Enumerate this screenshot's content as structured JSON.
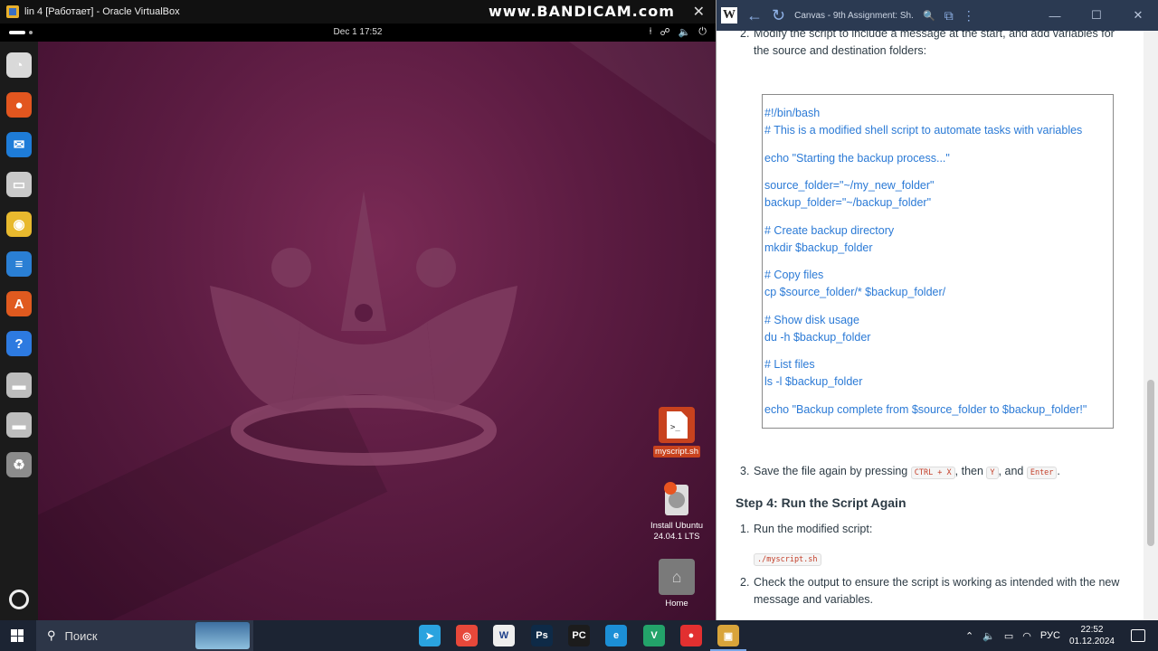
{
  "vbox": {
    "window_title": "lin 4 [Работает] - Oracle VirtualBox",
    "watermark": "www.BANDICAM.com",
    "close": "✕"
  },
  "ubuntu": {
    "clock": "Dec 1  17:52",
    "tray": [
      "⍿",
      "☍",
      "🔈",
      "⏻"
    ],
    "desktop_icons": [
      {
        "label": "myscript.sh",
        "icon": "script-file-icon",
        "selected": true
      },
      {
        "label": "Install Ubuntu 24.04.1 LTS",
        "icon": "ubuntu-installer-icon",
        "selected": false
      },
      {
        "label": "Home",
        "icon": "home-folder-icon",
        "selected": false
      }
    ],
    "dock": [
      {
        "name": "ubuntu-installer-icon",
        "glyph": "◔",
        "color": "#d9d9d9"
      },
      {
        "name": "firefox-icon",
        "glyph": "●",
        "color": "#e2561f"
      },
      {
        "name": "thunderbird-icon",
        "glyph": "✉",
        "color": "#1e7cd8"
      },
      {
        "name": "files-icon",
        "glyph": "▭",
        "color": "#c9c9c9"
      },
      {
        "name": "rhythmbox-icon",
        "glyph": "◉",
        "color": "#e8b92e"
      },
      {
        "name": "writer-icon",
        "glyph": "≡",
        "color": "#2a7fd4"
      },
      {
        "name": "app-center-icon",
        "glyph": "A",
        "color": "#e05a1f"
      },
      {
        "name": "help-icon",
        "glyph": "?",
        "color": "#2d7ae0"
      },
      {
        "name": "drive-icon",
        "glyph": "▬",
        "color": "#bdbdbd"
      },
      {
        "name": "drive-icon-2",
        "glyph": "▬",
        "color": "#bdbdbd"
      },
      {
        "name": "trash-icon",
        "glyph": "♻",
        "color": "#8c8c8c"
      }
    ]
  },
  "browser": {
    "tab_title": "Canvas - 9th Assignment: Sh...",
    "logo": "W",
    "back": "←",
    "reload": "↻",
    "zoom": "🔍",
    "extensions": "⧉",
    "menu": "⋮",
    "minimize": "—",
    "maximize": "☐",
    "close": "✕"
  },
  "doc": {
    "step2_num": "2.",
    "step2_text": "Modify the script to include a message at the start, and add variables for the source and destination folders:",
    "code_lines": [
      "#!/bin/bash",
      "# This is a modified shell script to automate tasks with variables",
      "",
      "echo \"Starting the backup process...\"",
      "",
      "source_folder=\"~/my_new_folder\"",
      "backup_folder=\"~/backup_folder\"",
      "",
      "# Create backup directory",
      "mkdir $backup_folder",
      "",
      "# Copy files",
      "cp $source_folder/* $backup_folder/",
      "",
      "# Show disk usage",
      "du -h $backup_folder",
      "",
      "# List files",
      "ls -l $backup_folder",
      "",
      "echo \"Backup complete from $source_folder to $backup_folder!\""
    ],
    "step3_num": "3.",
    "step3_pre": "Save the file again by pressing ",
    "step3_key1": "CTRL + X",
    "step3_mid": ", then ",
    "step3_key2": "Y",
    "step3_and": ", and ",
    "step3_key3": "Enter",
    "step3_end": ".",
    "heading": "Step 4: Run the Script Again",
    "s4_1_num": "1.",
    "s4_1_text": "Run the modified script:",
    "run_cmd": "./myscript.sh",
    "s4_2_num": "2.",
    "s4_2_text": "Check the output to ensure the script is working as intended with the new message and variables."
  },
  "taskbar": {
    "search_placeholder": "Поиск",
    "apps": [
      {
        "name": "telegram-icon",
        "glyph": "➤",
        "bg": "#2aa3df"
      },
      {
        "name": "chrome-icon",
        "glyph": "◎",
        "bg": "#e7483a"
      },
      {
        "name": "word-icon",
        "glyph": "W",
        "bg": "#eeeeee"
      },
      {
        "name": "photoshop-icon",
        "glyph": "Ps",
        "bg": "#0e2a47"
      },
      {
        "name": "pycharm-icon",
        "glyph": "PC",
        "bg": "#1c1c1c"
      },
      {
        "name": "edge-icon",
        "glyph": "e",
        "bg": "#1c8fd6"
      },
      {
        "name": "vscode-icon",
        "glyph": "V",
        "bg": "#23a36a"
      },
      {
        "name": "bandicam-icon",
        "glyph": "●",
        "bg": "#e23030"
      },
      {
        "name": "virtualbox-icon",
        "glyph": "▣",
        "bg": "#d9a43a"
      }
    ],
    "tray_chevron": "⌃",
    "tray_sound": "🔈",
    "tray_battery": "▭",
    "tray_wifi": "◠",
    "lang": "РУС",
    "time": "22:52",
    "date": "01.12.2024"
  }
}
